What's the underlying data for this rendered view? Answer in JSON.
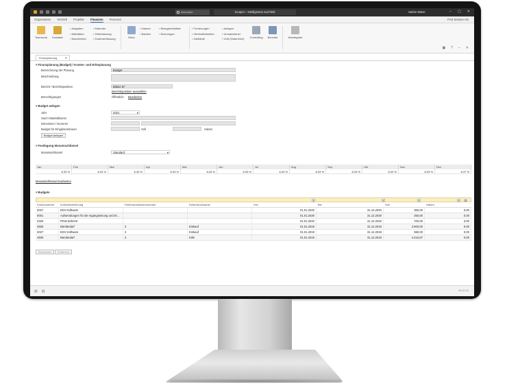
{
  "window": {
    "search_placeholder": "Abschalte",
    "app_title": "Scopen – Intelligentes Suchfeld",
    "user": "Stefan Walze",
    "company": "FAS Service AG"
  },
  "menu_tabs": [
    "Organisation",
    "Vertrieb",
    "Projekte",
    "Finanzen",
    "Personal"
  ],
  "active_tab": "Finanzen",
  "ribbon": {
    "teamwork": "Teamwork",
    "kontakte": "Kontakte",
    "col1": [
      "Aufgaben",
      "Aktivitäten",
      "Nachrichten"
    ],
    "col2": [
      "Kalender",
      "Zielerfassung",
      "Kostenerfassung"
    ],
    "rebu": "Rebu",
    "col3": [
      "Kassen",
      "Banken"
    ],
    "col4": [
      "Belegarbeitsliste",
      "Buchungen"
    ],
    "col5": [
      "Forderungen",
      "Verbindlichkeiten",
      "Zahlläufe"
    ],
    "col6": [
      "Anlagen",
      "Umsatzsteuer",
      "UVA (Österreich)"
    ],
    "controlling": "Controlling",
    "berichte": "Berichte",
    "arbeitsplatz": "Arbeitsplatz"
  },
  "doc_tab": "Finanzplanung",
  "planning": {
    "section": "Finanzplanung (Budget) / Kosten- und Erlösplanung",
    "name_label": "Bezeichnung der Planung",
    "name_value": "Budget",
    "desc_label": "Beschreibung",
    "report_label": "Bericht / Berichtsposition",
    "report_value": "Bilanz 67",
    "report_link": "Berichtsposition auswählen",
    "perm_label": "Berechtigungen",
    "perm_value": "Öffentlich",
    "perm_link": "Bearbeiten"
  },
  "create": {
    "section": "Budget anlegen",
    "year_label": "Jahr",
    "year_value": "2021",
    "account_label": "Sach-/Statistikkonto",
    "dim_label": "Dimension / Nummer",
    "amount_label": "Budget für Eingabezeitraum",
    "soll": "Soll",
    "haben": "Haben",
    "button": "Budget anlegen"
  },
  "key": {
    "section": "Festlegung Monatsschlüssel",
    "label": "Monatsschlüssel",
    "value": "Standard",
    "months": [
      "Jan",
      "Feb",
      "Mar",
      "Apr",
      "Mai",
      "Jun",
      "Jul",
      "Aug",
      "Sep",
      "Okt",
      "Nov",
      "Dez"
    ],
    "values": [
      "8,33 %",
      "8,33 %",
      "8,33 %",
      "8,33 %",
      "8,33 %",
      "8,33 %",
      "8,33 %",
      "8,33 %",
      "8,33 %",
      "8,33 %",
      "8,33 %",
      "8,37 %"
    ],
    "edit_link": "Monatsschlüssel bearbeiten"
  },
  "budgets": {
    "section": "Budgets",
    "columns": [
      "Kontonummer",
      "Kontobezeichnung",
      "Dimensionskontonummer",
      "Dimensionsname",
      "Von",
      "Bis",
      "Soll",
      "Haben"
    ],
    "rows": [
      [
        "0027",
        "EDV-Software",
        "",
        "",
        "01.01.2020",
        "31.12.2020",
        "350,00",
        "0,00"
      ],
      [
        "0001",
        "Aufwendungen für die Ingangsetzung und Er...",
        "",
        "",
        "01.01.2020",
        "31.12.2020",
        "250,00",
        "0,00"
      ],
      [
        "0320",
        "PKW-Zahnrör",
        "",
        "",
        "01.01.2020",
        "31.12.2020",
        "700,00",
        "0,00"
      ],
      [
        "4930",
        "Bürobedarf",
        "2",
        "Einkauf",
        "01.01.2019",
        "31.12.2019",
        "2.900,00",
        "0,00"
      ],
      [
        "0027",
        "EDV-Software",
        "2",
        "Einkauf",
        "01.01.2019",
        "31.12.2019",
        "590,00",
        "0,00"
      ],
      [
        "4930",
        "Bürobedarf",
        "3",
        "Köln",
        "01.01.2019",
        "31.12.2019",
        "4.216,67",
        "0,00"
      ]
    ],
    "edit_button": "Bearbeiten",
    "delete_button": "Entfernen"
  },
  "status": {
    "version": "V8.00.00"
  }
}
